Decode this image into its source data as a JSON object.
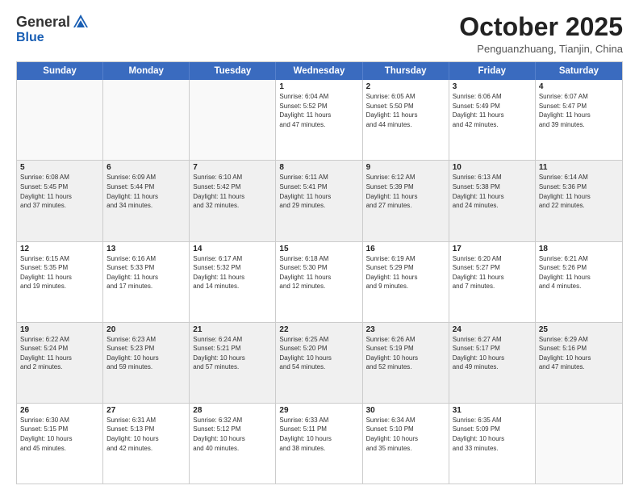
{
  "logo": {
    "general": "General",
    "blue": "Blue"
  },
  "header": {
    "month": "October 2025",
    "location": "Penguanzhuang, Tianjin, China"
  },
  "days": [
    "Sunday",
    "Monday",
    "Tuesday",
    "Wednesday",
    "Thursday",
    "Friday",
    "Saturday"
  ],
  "weeks": [
    [
      {
        "day": "",
        "info": ""
      },
      {
        "day": "",
        "info": ""
      },
      {
        "day": "",
        "info": ""
      },
      {
        "day": "1",
        "info": "Sunrise: 6:04 AM\nSunset: 5:52 PM\nDaylight: 11 hours\nand 47 minutes."
      },
      {
        "day": "2",
        "info": "Sunrise: 6:05 AM\nSunset: 5:50 PM\nDaylight: 11 hours\nand 44 minutes."
      },
      {
        "day": "3",
        "info": "Sunrise: 6:06 AM\nSunset: 5:49 PM\nDaylight: 11 hours\nand 42 minutes."
      },
      {
        "day": "4",
        "info": "Sunrise: 6:07 AM\nSunset: 5:47 PM\nDaylight: 11 hours\nand 39 minutes."
      }
    ],
    [
      {
        "day": "5",
        "info": "Sunrise: 6:08 AM\nSunset: 5:45 PM\nDaylight: 11 hours\nand 37 minutes."
      },
      {
        "day": "6",
        "info": "Sunrise: 6:09 AM\nSunset: 5:44 PM\nDaylight: 11 hours\nand 34 minutes."
      },
      {
        "day": "7",
        "info": "Sunrise: 6:10 AM\nSunset: 5:42 PM\nDaylight: 11 hours\nand 32 minutes."
      },
      {
        "day": "8",
        "info": "Sunrise: 6:11 AM\nSunset: 5:41 PM\nDaylight: 11 hours\nand 29 minutes."
      },
      {
        "day": "9",
        "info": "Sunrise: 6:12 AM\nSunset: 5:39 PM\nDaylight: 11 hours\nand 27 minutes."
      },
      {
        "day": "10",
        "info": "Sunrise: 6:13 AM\nSunset: 5:38 PM\nDaylight: 11 hours\nand 24 minutes."
      },
      {
        "day": "11",
        "info": "Sunrise: 6:14 AM\nSunset: 5:36 PM\nDaylight: 11 hours\nand 22 minutes."
      }
    ],
    [
      {
        "day": "12",
        "info": "Sunrise: 6:15 AM\nSunset: 5:35 PM\nDaylight: 11 hours\nand 19 minutes."
      },
      {
        "day": "13",
        "info": "Sunrise: 6:16 AM\nSunset: 5:33 PM\nDaylight: 11 hours\nand 17 minutes."
      },
      {
        "day": "14",
        "info": "Sunrise: 6:17 AM\nSunset: 5:32 PM\nDaylight: 11 hours\nand 14 minutes."
      },
      {
        "day": "15",
        "info": "Sunrise: 6:18 AM\nSunset: 5:30 PM\nDaylight: 11 hours\nand 12 minutes."
      },
      {
        "day": "16",
        "info": "Sunrise: 6:19 AM\nSunset: 5:29 PM\nDaylight: 11 hours\nand 9 minutes."
      },
      {
        "day": "17",
        "info": "Sunrise: 6:20 AM\nSunset: 5:27 PM\nDaylight: 11 hours\nand 7 minutes."
      },
      {
        "day": "18",
        "info": "Sunrise: 6:21 AM\nSunset: 5:26 PM\nDaylight: 11 hours\nand 4 minutes."
      }
    ],
    [
      {
        "day": "19",
        "info": "Sunrise: 6:22 AM\nSunset: 5:24 PM\nDaylight: 11 hours\nand 2 minutes."
      },
      {
        "day": "20",
        "info": "Sunrise: 6:23 AM\nSunset: 5:23 PM\nDaylight: 10 hours\nand 59 minutes."
      },
      {
        "day": "21",
        "info": "Sunrise: 6:24 AM\nSunset: 5:21 PM\nDaylight: 10 hours\nand 57 minutes."
      },
      {
        "day": "22",
        "info": "Sunrise: 6:25 AM\nSunset: 5:20 PM\nDaylight: 10 hours\nand 54 minutes."
      },
      {
        "day": "23",
        "info": "Sunrise: 6:26 AM\nSunset: 5:19 PM\nDaylight: 10 hours\nand 52 minutes."
      },
      {
        "day": "24",
        "info": "Sunrise: 6:27 AM\nSunset: 5:17 PM\nDaylight: 10 hours\nand 49 minutes."
      },
      {
        "day": "25",
        "info": "Sunrise: 6:29 AM\nSunset: 5:16 PM\nDaylight: 10 hours\nand 47 minutes."
      }
    ],
    [
      {
        "day": "26",
        "info": "Sunrise: 6:30 AM\nSunset: 5:15 PM\nDaylight: 10 hours\nand 45 minutes."
      },
      {
        "day": "27",
        "info": "Sunrise: 6:31 AM\nSunset: 5:13 PM\nDaylight: 10 hours\nand 42 minutes."
      },
      {
        "day": "28",
        "info": "Sunrise: 6:32 AM\nSunset: 5:12 PM\nDaylight: 10 hours\nand 40 minutes."
      },
      {
        "day": "29",
        "info": "Sunrise: 6:33 AM\nSunset: 5:11 PM\nDaylight: 10 hours\nand 38 minutes."
      },
      {
        "day": "30",
        "info": "Sunrise: 6:34 AM\nSunset: 5:10 PM\nDaylight: 10 hours\nand 35 minutes."
      },
      {
        "day": "31",
        "info": "Sunrise: 6:35 AM\nSunset: 5:09 PM\nDaylight: 10 hours\nand 33 minutes."
      },
      {
        "day": "",
        "info": ""
      }
    ]
  ]
}
